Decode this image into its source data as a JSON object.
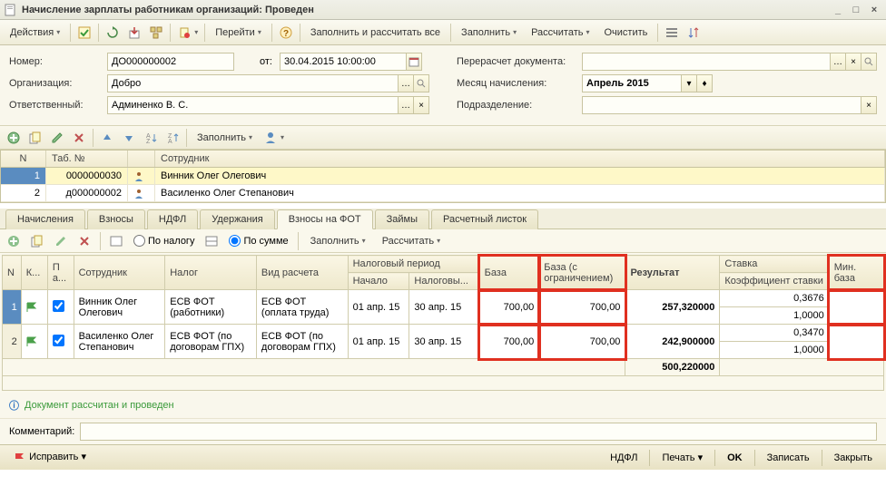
{
  "title": "Начисление зарплаты работникам организаций: Проведен",
  "toolbar": {
    "actions": "Действия",
    "go": "Перейти",
    "fill_calc_all": "Заполнить и рассчитать все",
    "fill": "Заполнить",
    "calc": "Рассчитать",
    "clear": "Очистить"
  },
  "form": {
    "number_lbl": "Номер:",
    "number": "ДО000000002",
    "date_lbl": "от:",
    "date": "30.04.2015 10:00:00",
    "org_lbl": "Организация:",
    "org": "Добро",
    "resp_lbl": "Ответственный:",
    "resp": "Админенко В. С.",
    "recalc_lbl": "Перерасчет документа:",
    "month_lbl": "Месяц начисления:",
    "month": "Апрель 2015",
    "dept_lbl": "Подразделение:"
  },
  "sub": {
    "fill": "Заполнить"
  },
  "emp_grid": {
    "h_n": "N",
    "h_tab": "Таб. №",
    "h_emp": "Сотрудник",
    "rows": [
      {
        "n": "1",
        "tab": "0000000030",
        "name": "Винник Олег Олегович"
      },
      {
        "n": "2",
        "tab": "д000000002",
        "name": "Василенко Олег Степанович"
      }
    ]
  },
  "tabs": {
    "t1": "Начисления",
    "t2": "Взносы",
    "t3": "НДФЛ",
    "t4": "Удержания",
    "t5": "Взносы на ФОТ",
    "t6": "Займы",
    "t7": "Расчетный листок"
  },
  "tabtb": {
    "by_tax": "По налогу",
    "by_sum": "По сумме",
    "fill": "Заполнить",
    "calc": "Рассчитать"
  },
  "grid": {
    "h_n": "N",
    "h_k": "К...",
    "h_p": "П\nа...",
    "h_emp": "Сотрудник",
    "h_tax": "Налог",
    "h_calc": "Вид расчета",
    "h_period": "Налоговый период",
    "h_start": "Начало",
    "h_taxp": "Налоговы...",
    "h_base": "База",
    "h_base_lim": "База (с ограничением)",
    "h_result": "Результат",
    "h_rate": "Ставка",
    "h_coef": "Коэффициент ставки",
    "h_minbase": "Мин. база",
    "rows": [
      {
        "n": "1",
        "emp": "Винник Олег Олегович",
        "tax": "ЕСВ ФОТ (работники)",
        "calc": "ЕСВ ФОТ (оплата труда)",
        "start": "01 апр. 15",
        "end": "30 апр. 15",
        "base": "700,00",
        "base_lim": "700,00",
        "result": "257,320000",
        "rate": "0,3676",
        "coef": "1,0000"
      },
      {
        "n": "2",
        "emp": "Василенко Олег Степанович",
        "tax": "ЕСВ ФОТ (по договорам ГПХ)",
        "calc": "ЕСВ ФОТ (по договорам ГПХ)",
        "start": "01 апр. 15",
        "end": "30 апр. 15",
        "base": "700,00",
        "base_lim": "700,00",
        "result": "242,900000",
        "rate": "0,3470",
        "coef": "1,0000"
      }
    ],
    "total": "500,220000"
  },
  "status": "Документ рассчитан и проведен",
  "comment_lbl": "Комментарий:",
  "footer": {
    "fix": "Исправить",
    "ndfl": "НДФЛ",
    "print": "Печать",
    "ok": "OK",
    "save": "Записать",
    "close": "Закрыть"
  }
}
